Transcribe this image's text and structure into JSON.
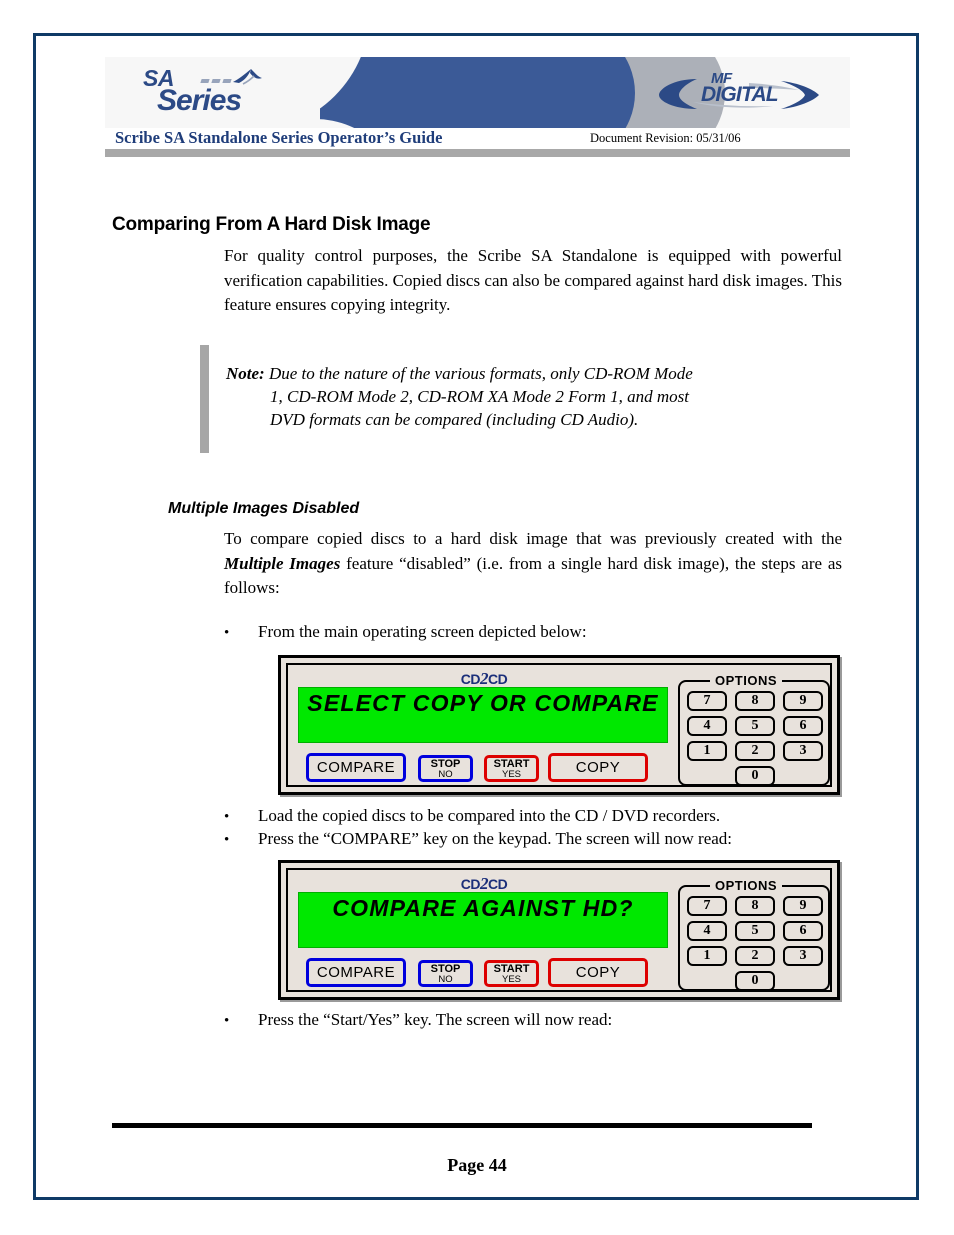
{
  "page": {
    "page_label": "Page 44",
    "border_color": "#0f3a66"
  },
  "header": {
    "sa_logo": {
      "line1": "SA",
      "line2": "Series"
    },
    "mf_logo": {
      "line1": "MF",
      "line2": "DIGITAL"
    },
    "guide_title": "Scribe SA Standalone Series Operator’s Guide",
    "document_revision": "Document Revision: 05/31/06",
    "accent_blue": "#3b5a97",
    "accent_gray": "#acb0b8",
    "title_color": "#1f3d7a"
  },
  "content": {
    "heading1": "Comparing From A Hard Disk Image",
    "paragraph_intro": "For quality control purposes, the Scribe SA Standalone is equipped with powerful verification capabilities. Copied discs can also be compared against hard disk images. This feature ensures copying integrity.",
    "note": {
      "label": "Note:",
      "line1": "Due to the nature of the various formats, only CD-ROM Mode",
      "line2": "1, CD-ROM Mode 2, CD-ROM XA Mode 2 Form 1, and most",
      "line3": "DVD  formats can be compared (including CD Audio)."
    },
    "heading2": "Multiple Images Disabled",
    "paragraph_tocompare_part1": "To compare copied discs to a hard disk image that was previously created with the ",
    "paragraph_tocompare_emphasis": "Multiple Images",
    "paragraph_tocompare_part2": " feature “disabled” (i.e. from a single hard disk image), the steps are as follows:",
    "bullets": [
      "From the main operating screen depicted below:",
      "Load the copied discs to be compared into the CD / DVD recorders.",
      "Press the “COMPARE” key on the keypad. The screen will now read:",
      "Press the “Start/Yes” key. The screen will now read:"
    ],
    "bullet_glyph": "•"
  },
  "device_panels": [
    {
      "brand_logo_left": "CD",
      "brand_logo_mid": "2",
      "brand_logo_right": "CD",
      "lcd_text": "SELECT COPY OR COMPARE",
      "lcd_color": "#00e800",
      "panel_bg": "#e8e2dc",
      "buttons": {
        "compare": "COMPARE",
        "stop_top": "STOP",
        "stop_bottom": "NO",
        "start_top": "START",
        "start_bottom": "YES",
        "copy": "COPY",
        "compare_border": "#0000dd",
        "stop_border": "#0000dd",
        "start_border": "#dd0000",
        "copy_border": "#dd0000"
      },
      "options": {
        "label": "OPTIONS",
        "keys": [
          "7",
          "8",
          "9",
          "4",
          "5",
          "6",
          "1",
          "2",
          "3",
          "0"
        ]
      }
    },
    {
      "brand_logo_left": "CD",
      "brand_logo_mid": "2",
      "brand_logo_right": "CD",
      "lcd_text": "COMPARE AGAINST HD?",
      "lcd_color": "#00e800",
      "panel_bg": "#e8e2dc",
      "buttons": {
        "compare": "COMPARE",
        "stop_top": "STOP",
        "stop_bottom": "NO",
        "start_top": "START",
        "start_bottom": "YES",
        "copy": "COPY",
        "compare_border": "#0000dd",
        "stop_border": "#0000dd",
        "start_border": "#dd0000",
        "copy_border": "#dd0000"
      },
      "options": {
        "label": "OPTIONS",
        "keys": [
          "7",
          "8",
          "9",
          "4",
          "5",
          "6",
          "1",
          "2",
          "3",
          "0"
        ]
      }
    }
  ]
}
